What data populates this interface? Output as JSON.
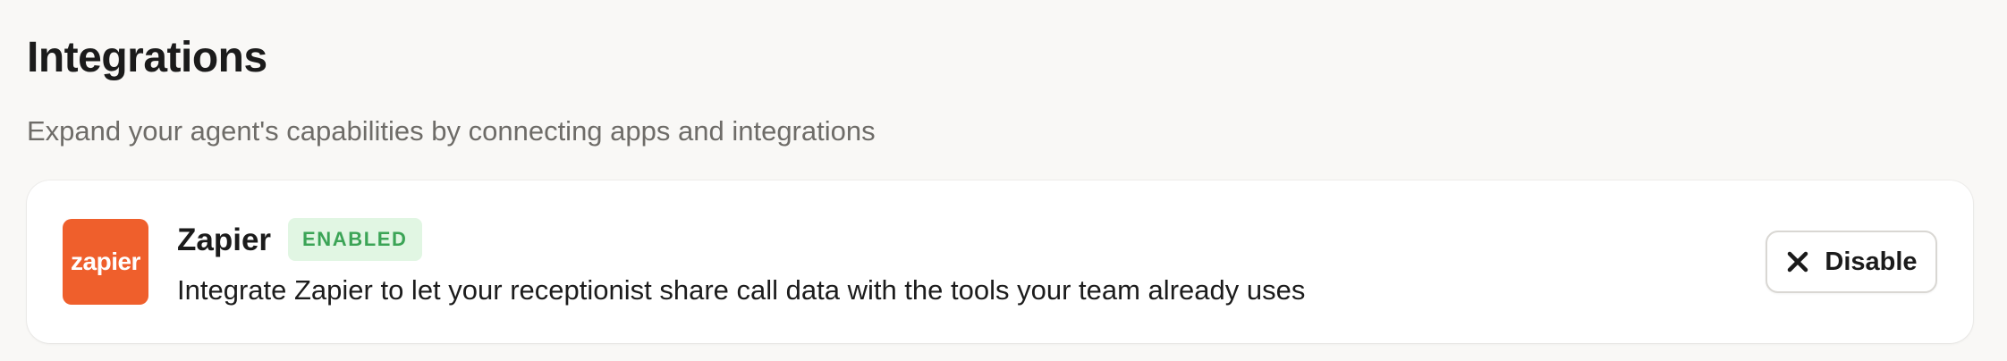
{
  "header": {
    "title": "Integrations",
    "subtitle": "Expand your agent's capabilities by connecting apps and integrations"
  },
  "integrations": [
    {
      "name": "Zapier",
      "logo_text": "zapier",
      "logo_color": "#ef5f2c",
      "status": "ENABLED",
      "status_color": "#3ba456",
      "description": "Integrate Zapier to let your receptionist share call data with the tools your team already uses",
      "action": {
        "label": "Disable",
        "icon": "close-icon"
      }
    }
  ]
}
